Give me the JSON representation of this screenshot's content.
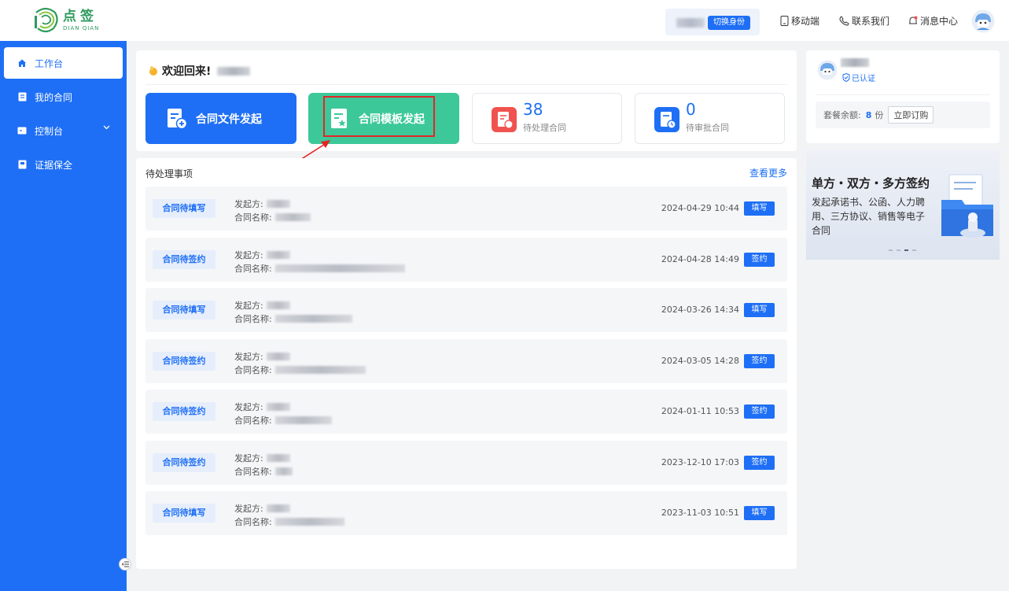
{
  "app": {
    "logo_cn": "点签",
    "logo_en": "DIAN QIAN"
  },
  "topbar": {
    "switch_identity": "切换身份",
    "links": [
      {
        "icon": "mobile-icon",
        "label": "移动端"
      },
      {
        "icon": "phone-icon",
        "label": "联系我们"
      },
      {
        "icon": "bell-icon",
        "label": "消息中心"
      }
    ]
  },
  "sidebar": {
    "items": [
      {
        "icon": "home-icon",
        "label": "工作台",
        "active": true
      },
      {
        "icon": "contract-icon",
        "label": "我的合同"
      },
      {
        "icon": "console-icon",
        "label": "控制台",
        "expandable": true
      },
      {
        "icon": "evidence-icon",
        "label": "证据保全"
      }
    ]
  },
  "welcome": {
    "text": "欢迎回来!"
  },
  "actions": {
    "file_start": "合同文件发起",
    "template_start": "合同模板发起"
  },
  "stats": [
    {
      "value": "38",
      "label": "待处理合同",
      "color": "#f0534f"
    },
    {
      "value": "0",
      "label": "待审批合同",
      "color": "#1e6ff5"
    }
  ],
  "todo": {
    "title": "待处理事项",
    "more": "查看更多",
    "sender_label": "发起方:",
    "name_label": "合同名称:",
    "rows": [
      {
        "tag": "合同待填写",
        "date": "2024-04-29 10:44",
        "action": "填写"
      },
      {
        "tag": "合同待签约",
        "date": "2024-04-28 14:49",
        "action": "签约"
      },
      {
        "tag": "合同待填写",
        "date": "2024-03-26 14:34",
        "action": "填写"
      },
      {
        "tag": "合同待签约",
        "date": "2024-03-05 14:28",
        "action": "签约"
      },
      {
        "tag": "合同待签约",
        "date": "2024-01-11 10:53",
        "action": "签约"
      },
      {
        "tag": "合同待签约",
        "date": "2023-12-10 17:03",
        "action": "签约"
      },
      {
        "tag": "合同待填写",
        "date": "2023-11-03 10:51",
        "action": "填写"
      }
    ]
  },
  "user_panel": {
    "verified": "已认证",
    "quota_label": "套餐余额:",
    "quota_value": "8",
    "quota_unit": "份",
    "subscribe": "立即订购"
  },
  "banner": {
    "title": "单方・双方・多方签约",
    "desc": "发起承诺书、公函、人力聘用、三方协议、销售等电子合同"
  },
  "colors": {
    "primary": "#1e6ff5",
    "green": "#3dc89a",
    "highlight": "#e32525"
  }
}
